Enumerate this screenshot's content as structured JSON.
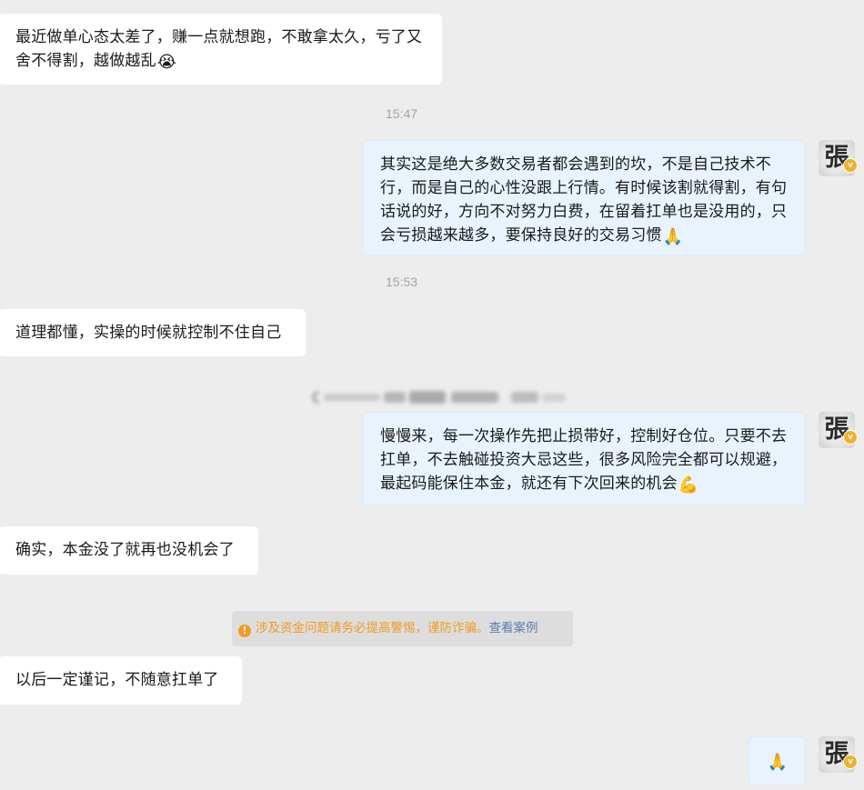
{
  "messages": [
    {
      "id": "m1",
      "side": "in",
      "text": "最近做单心态太差了，赚一点就想跑，不敢拿太久，亏了又舍不得割，越做越乱",
      "emoji": "😭"
    },
    {
      "id": "t1",
      "type": "time",
      "text": "15:47"
    },
    {
      "id": "m2",
      "side": "out",
      "text": "其实这是绝大多数交易者都会遇到的坎，不是自己技术不行，而是自己的心性没跟上行情。有时候该割就得割，有句话说的好，方向不对努力白费，在留着扛单也是没用的，只会亏损越来越多，要保持良好的交易习惯",
      "emoji": "🙏"
    },
    {
      "id": "t2",
      "type": "time",
      "text": "15:53"
    },
    {
      "id": "m3",
      "side": "in",
      "text": "道理都懂，实操的时候就控制不住自己"
    },
    {
      "id": "m4",
      "side": "out",
      "text": "慢慢来，每一次操作先把止损带好，控制好仓位。只要不去扛单，不去触碰投资大忌这些，很多风险完全都可以规避，最起码能保住本金，就还有下次回来的机会",
      "emoji": "💪"
    },
    {
      "id": "m5",
      "side": "in",
      "text": "确实，本金没了就再也没机会了"
    },
    {
      "id": "m6",
      "side": "in",
      "text": "以后一定谨记，不随意扛单了"
    },
    {
      "id": "m7",
      "side": "out",
      "text": "",
      "emoji": "🙏"
    }
  ],
  "notice": {
    "icon": "warning-icon",
    "text": "涉及资金问题请务必提高警惕，谨防诈骗。",
    "link": "查看案例"
  },
  "avatar": {
    "glyph": "張",
    "badge": "v"
  },
  "colors": {
    "background": "#ededed",
    "incoming_bubble": "#ffffff",
    "outgoing_bubble": "#e8f3fe",
    "timestamp": "#a4a4a4",
    "warning": "#f39a1f",
    "link": "#5b7fb1",
    "verified_badge": "#f0b12a"
  }
}
